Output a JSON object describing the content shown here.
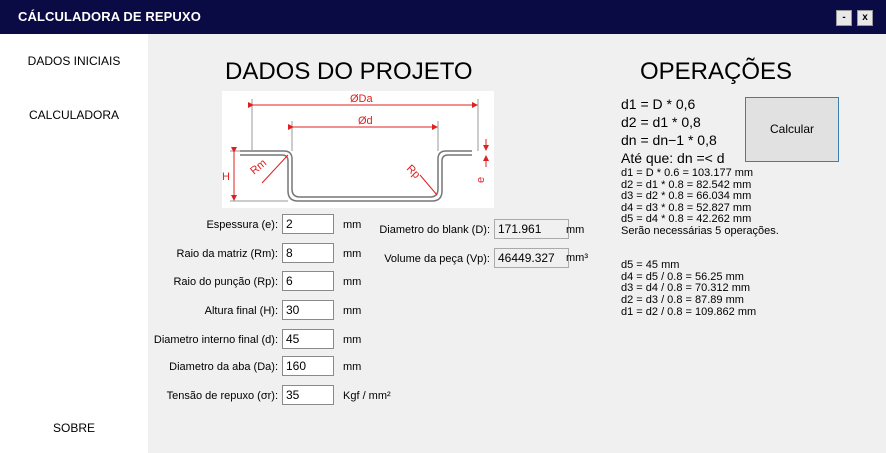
{
  "window": {
    "title": "CÁLCULADORA DE REPUXO",
    "min_label": "-",
    "close_label": "x"
  },
  "sidebar": {
    "items": [
      {
        "label": "DADOS INICIAIS"
      },
      {
        "label": "CALCULADORA"
      },
      {
        "label": "SOBRE"
      }
    ]
  },
  "headings": {
    "project": "DADOS DO PROJETO",
    "operations": "OPERAÇÕES"
  },
  "drawing": {
    "da": "ØDa",
    "d": "Ød",
    "h": "H",
    "rm": "Rm",
    "rp": "Rp",
    "e": "e"
  },
  "inputs": [
    {
      "label": "Espessura (e):",
      "value": "2",
      "unit": "mm"
    },
    {
      "label": "Raio da matriz (Rm):",
      "value": "8",
      "unit": "mm"
    },
    {
      "label": "Raio do punção (Rp):",
      "value": "6",
      "unit": "mm"
    },
    {
      "label": "Altura final (H):",
      "value": "30",
      "unit": "mm"
    },
    {
      "label": "Diametro interno final (d):",
      "value": "45",
      "unit": "mm"
    },
    {
      "label": "Diametro da aba (Da):",
      "value": "160",
      "unit": "mm"
    },
    {
      "label": "Tensão de repuxo (σr):",
      "value": "35",
      "unit": "Kgf / mm²"
    }
  ],
  "outputs": [
    {
      "label": "Diametro do blank (D):",
      "value": "171.961",
      "unit": "mm"
    },
    {
      "label": "Volume da peça (Vp):",
      "value": "46449.327",
      "unit": "mm³"
    }
  ],
  "formulas": [
    "d1 = D * 0,6",
    "d2 = d1 * 0,8",
    "dn = dn−1 * 0,8",
    "Até que: dn =< d"
  ],
  "calc_button": "Calcular",
  "results": [
    "d1 = D * 0.6 = 103.177 mm",
    "d2 = d1 * 0.8 = 82.542 mm",
    "d3 = d2 * 0.8 = 66.034 mm",
    "d4 = d3 * 0.8 = 52.827 mm",
    "d5 = d4 * 0.8 = 42.262 mm",
    "Serão necessárias 5 operações.",
    "",
    "d5 = 45 mm",
    "d4 = d5 / 0.8 = 56.25 mm",
    "d3 = d4 / 0.8 = 70.312 mm",
    "d2 = d3 / 0.8 = 87.89 mm",
    "d1 = d2 / 0.8 = 109.862 mm"
  ],
  "colors": {
    "titlebar": "#0a0a45",
    "dimension": "#e02020",
    "accent_border": "#3c7fb1"
  }
}
